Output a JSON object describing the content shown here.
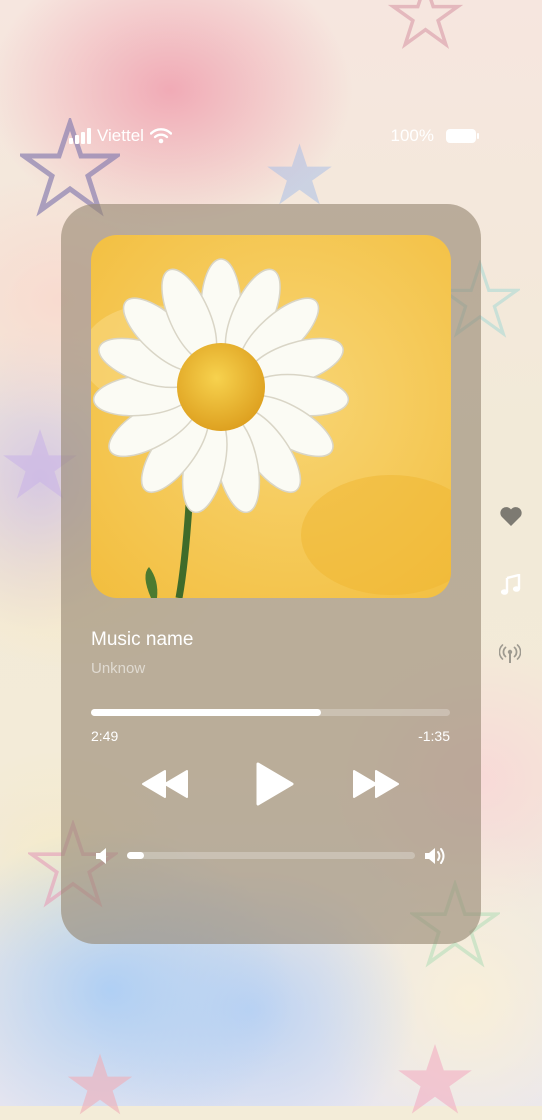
{
  "status_bar": {
    "carrier": "Viettel",
    "battery": "100%"
  },
  "player": {
    "song_title": "Music name",
    "artist": "Unknow",
    "elapsed": "2:49",
    "remaining": "-1:35",
    "progress_fraction": 0.64,
    "volume_fraction": 0.06
  },
  "side_actions": {
    "icons": [
      "heart-icon",
      "music-note-icon",
      "broadcast-icon"
    ]
  },
  "colors": {
    "card": "#968773",
    "art_background": "#f6c74a",
    "text": "#ffffff"
  }
}
